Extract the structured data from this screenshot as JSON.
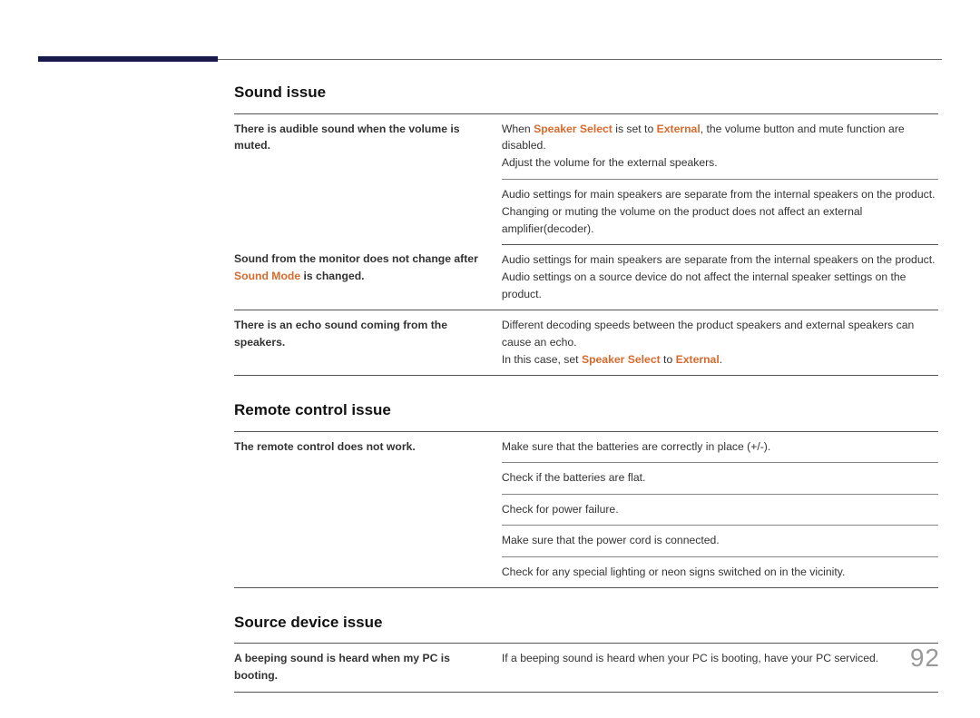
{
  "page_number": "92",
  "sections": {
    "sound": {
      "heading": "Sound issue",
      "rows": {
        "r1_left": "There is audible sound when the volume is muted.",
        "r1a_pre": "When ",
        "r1a_k1": "Speaker Select",
        "r1a_mid": " is set to ",
        "r1a_k2": "External",
        "r1a_post": ", the volume button and mute function are disabled.",
        "r1b": "Adjust the volume for the external speakers.",
        "r1c": "Audio settings for main speakers are separate from the internal speakers on the product.",
        "r1d": "Changing or muting the volume on the product does not affect an external amplifier(decoder).",
        "r2_left_pre": "Sound from the monitor does not change after ",
        "r2_left_k": "Sound Mode",
        "r2_left_post": " is changed.",
        "r2a": "Audio settings for main speakers are separate from the internal speakers on the product.",
        "r2b": "Audio settings on a source device do not affect the internal speaker settings on the product.",
        "r3_left": "There is an echo sound coming from the speakers.",
        "r3a": "Different decoding speeds between the product speakers and external speakers can cause an echo.",
        "r3b_pre": "In this case, set ",
        "r3b_k1": "Speaker Select",
        "r3b_mid": " to ",
        "r3b_k2": "External",
        "r3b_post": "."
      }
    },
    "remote": {
      "heading": "Remote control issue",
      "rows": {
        "r1_left": "The remote control does not work.",
        "r1a": "Make sure that the batteries are correctly in place (+/-).",
        "r1b": "Check if the batteries are flat.",
        "r1c": "Check for power failure.",
        "r1d": "Make sure that the power cord is connected.",
        "r1e": "Check for any special lighting or neon signs switched on in the vicinity."
      }
    },
    "source": {
      "heading": "Source device issue",
      "rows": {
        "r1_left": "A beeping sound is heard when my PC is booting.",
        "r1a": "If a beeping sound is heard when your PC is booting, have your PC serviced."
      }
    }
  }
}
